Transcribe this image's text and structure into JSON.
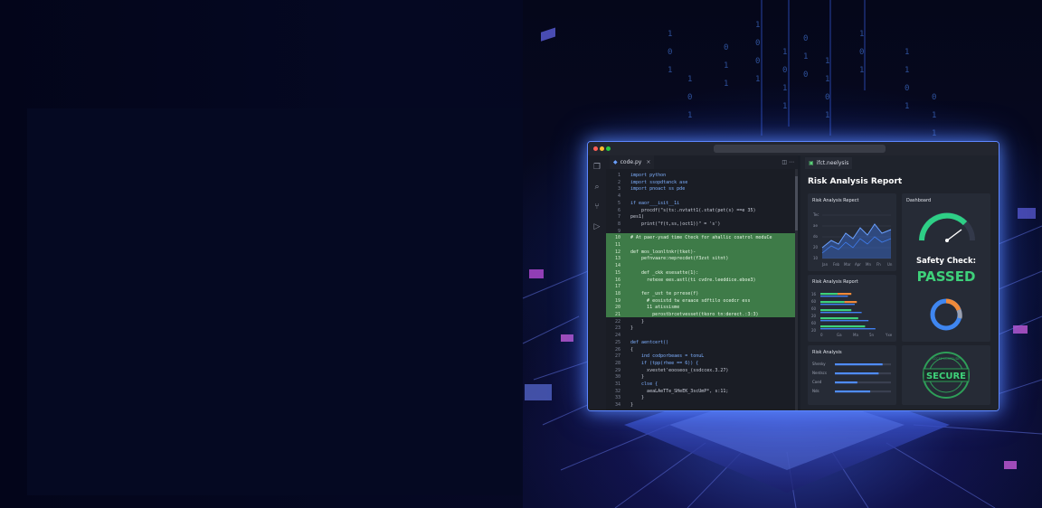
{
  "editor": {
    "tab": {
      "filename": "code.py",
      "close": "×",
      "icons": "◫ ⋯"
    },
    "lines": [
      {
        "n": "1",
        "text": "import python"
      },
      {
        "n": "2",
        "text": "import ssopdtanck ase"
      },
      {
        "n": "3",
        "text": "import pnoact ss pde"
      },
      {
        "n": "4",
        "text": ""
      },
      {
        "n": "5",
        "text": "if eaor___isit__1i"
      },
      {
        "n": "6",
        "text": "    procdf(\"s(ts:.nvtatt1(.stat(pet(s) ==e 35)"
      },
      {
        "n": "7",
        "text": "pes1)"
      },
      {
        "n": "8",
        "text": "    print(\"f(t,ss,)oct1))\" = 's')"
      },
      {
        "n": "9",
        "text": ""
      },
      {
        "n": "10",
        "text": "# At paer-ysad time Cteck for ahallic coatrol moduCe"
      },
      {
        "n": "11",
        "text": ""
      },
      {
        "n": "12",
        "text": "def mos_loonltnkr(tket)-"
      },
      {
        "n": "13",
        "text": "    pefnvaare:neprecdet(f3zst sitnt)"
      },
      {
        "n": "14",
        "text": ""
      },
      {
        "n": "15",
        "text": "    def _ckk esesatte(1):"
      },
      {
        "n": "16",
        "text": "      retexe ees.astl(ti cvdre.leeddice.eboe3)"
      },
      {
        "n": "17",
        "text": ""
      },
      {
        "n": "18",
        "text": "    fer _ust te prrese(f)"
      },
      {
        "n": "19",
        "text": "      # eosistd tw eraace sdftilo ocedcr ess"
      },
      {
        "n": "20",
        "text": "      11 atissisme"
      },
      {
        "n": "21",
        "text": "        perostbrcetvesset(tkoro tn:derect.:3:3)"
      },
      {
        "n": "22",
        "text": "    }"
      },
      {
        "n": "23",
        "text": "}"
      },
      {
        "n": "24",
        "text": ""
      },
      {
        "n": "25",
        "text": "def aentcert()"
      },
      {
        "n": "26",
        "text": "{"
      },
      {
        "n": "27",
        "text": "    ind codporbeaes = tonuL"
      },
      {
        "n": "28",
        "text": "    if (tpp(rhee == 6)) {"
      },
      {
        "n": "29",
        "text": "      xvestet'eooseos_(ssdccex.3.27)"
      },
      {
        "n": "30",
        "text": "    }"
      },
      {
        "n": "31",
        "text": "    clse {"
      },
      {
        "n": "32",
        "text": "      aeaLAeTTe_SHeEK_3scUmP*, s:11;"
      },
      {
        "n": "33",
        "text": "    }"
      },
      {
        "n": "34",
        "text": "}"
      }
    ]
  },
  "report": {
    "tab": "ifct.neelysis",
    "title": "Risk Analysis Report",
    "cards": {
      "risk_line": {
        "title": "Risk Analysis Repect",
        "y_ticks": [
          "Tec",
          "ae",
          "do",
          "20",
          "10"
        ],
        "x_ticks": [
          "Jan",
          "Feb",
          "Mar",
          "Apr",
          "Mn",
          "Fh",
          "Un"
        ]
      },
      "risk_bars": {
        "title": "Risk Analysis Report",
        "y_ticks": [
          "16",
          "60",
          "60",
          "20",
          "60",
          "20"
        ],
        "x_ticks": [
          "0",
          "Ga",
          "Ma",
          "5n",
          "Yxe"
        ],
        "bars": [
          {
            "green": 0.25,
            "orange": 0.2
          },
          {
            "green": 0.35,
            "orange": 0.18
          },
          {
            "green": 0.45,
            "orange": 0.0
          },
          {
            "green": 0.55,
            "orange": 0.0
          },
          {
            "green": 0.65,
            "orange": 0.0
          }
        ]
      },
      "risk_list": {
        "title": "Risk Analysis",
        "rows": [
          {
            "label": "Shenky",
            "level": 0.85
          },
          {
            "label": "Nerdscs",
            "level": 0.78
          },
          {
            "label": "Coed",
            "level": 0.4
          },
          {
            "label": "Nds",
            "level": 0.63
          }
        ]
      },
      "dashboard": {
        "title": "Dashboard",
        "safety_label": "Safety Check:",
        "status": "PASSED",
        "gauge_level": 0.8
      },
      "stamp": {
        "label": "SECURE",
        "ring_text": "SCCEE LCSPEUDE"
      }
    }
  },
  "colors": {
    "accent_blue": "#5d86ff",
    "pass_green": "#3ed17a",
    "highlight_green": "#4ca056",
    "orange": "#f08a3a"
  }
}
